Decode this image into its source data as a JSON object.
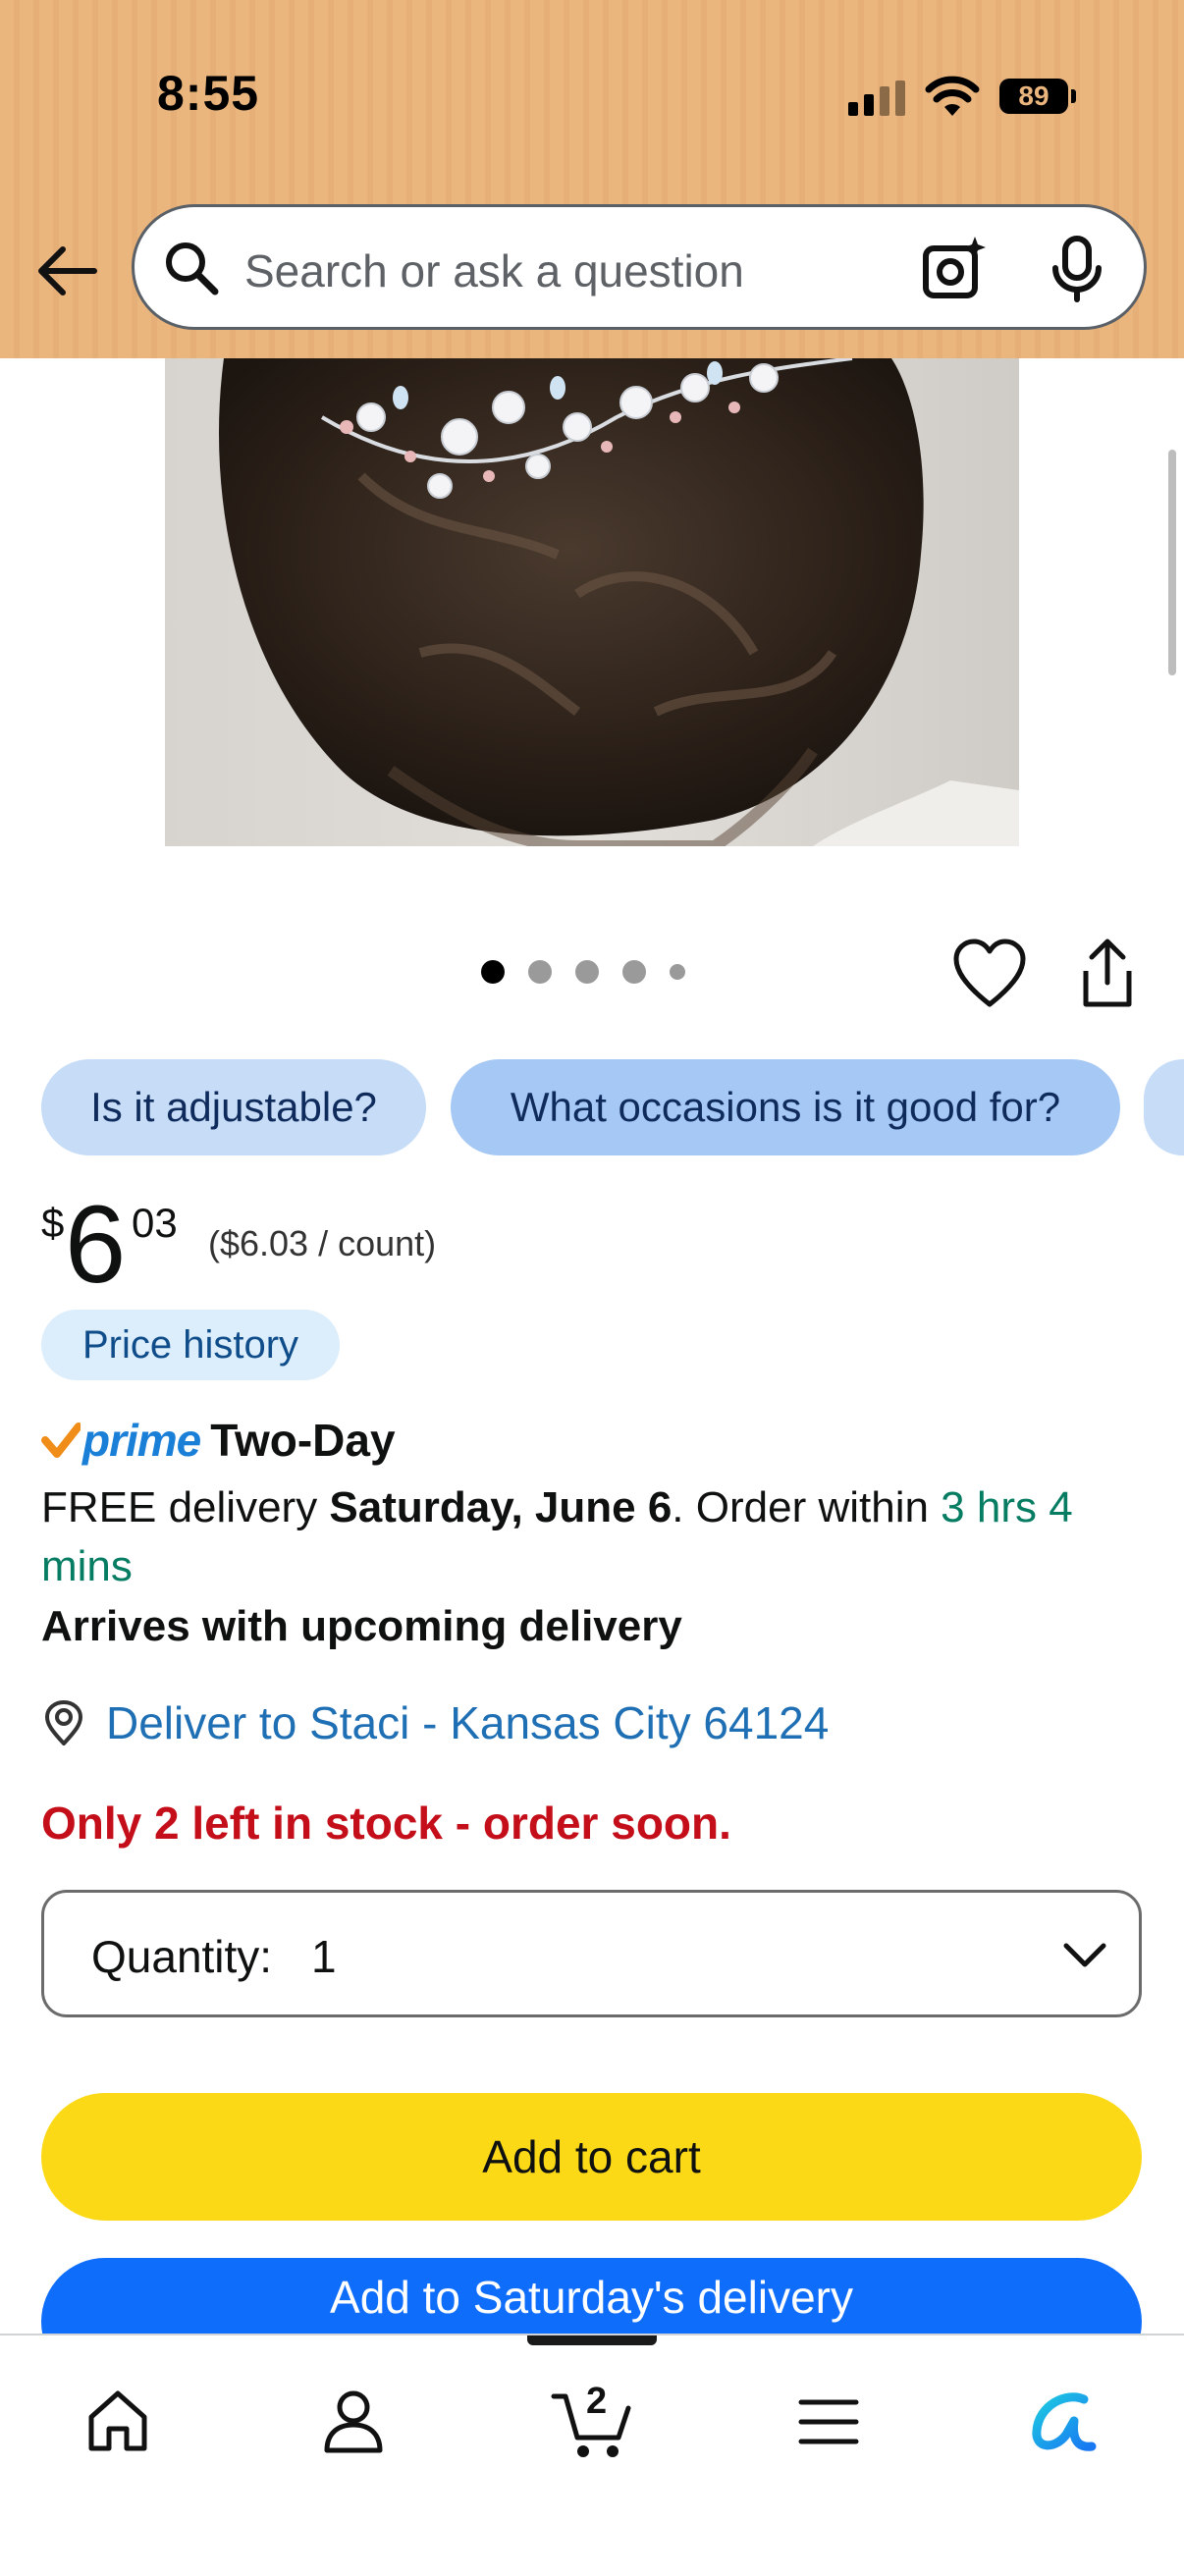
{
  "status_bar": {
    "time": "8:55",
    "battery": "89"
  },
  "header": {
    "search_placeholder": "Search or ask a question"
  },
  "product": {
    "image_name": "floral pearl bridal hair vine on updo",
    "carousel_count": 5,
    "carousel_active_index": 0
  },
  "chips": [
    "Is it adjustable?",
    "What occasions is it good for?"
  ],
  "price": {
    "currency": "$",
    "whole": "6",
    "cents": "03",
    "per_unit": "($6.03 / count)",
    "history_label": "Price history"
  },
  "delivery": {
    "prime_label": "prime",
    "prime_speed": "Two-Day",
    "free_prefix": "FREE delivery ",
    "date": "Saturday, June 6",
    "order_within_prefix": ". Order within ",
    "countdown": "3 hrs 4 mins",
    "upcoming": "Arrives with upcoming delivery",
    "deliver_to": "Deliver to Staci - Kansas City 64124",
    "stock_warning": "Only 2 left in stock - order soon."
  },
  "quantity": {
    "label": "Quantity:",
    "value": "1"
  },
  "buttons": {
    "add_to_cart": "Add to cart",
    "add_to_saturday": "Add to Saturday's delivery"
  },
  "bottom_nav": {
    "cart_count": "2"
  },
  "colors": {
    "header_bg": "#ebb57e",
    "chip_bg": "#c6dcf7",
    "add_to_cart": "#fcd916",
    "add_saturday": "#0f6dfc",
    "link_blue": "#1f6fb5",
    "green": "#067d62",
    "stock_red": "#c40f1a"
  }
}
